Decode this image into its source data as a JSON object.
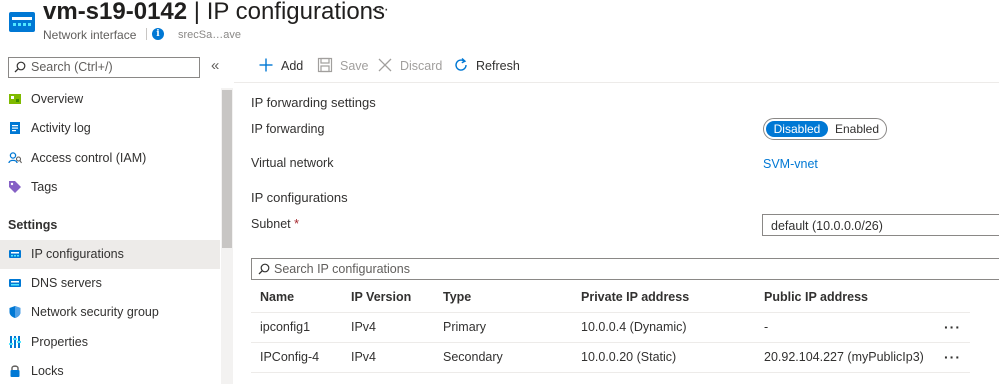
{
  "header": {
    "resource_name": "vm-s19-0142",
    "separator": " | ",
    "page_title": "IP configurations",
    "more_label": "···",
    "resource_type": "Network interface",
    "faded_text": "srecSa…ave"
  },
  "sidebar": {
    "search_placeholder": "Search (Ctrl+/)",
    "collapse_label": "«",
    "items": [
      {
        "label": "Overview",
        "icon": "overview-icon"
      },
      {
        "label": "Activity log",
        "icon": "activity-log-icon"
      },
      {
        "label": "Access control (IAM)",
        "icon": "iam-icon"
      },
      {
        "label": "Tags",
        "icon": "tag-icon"
      }
    ],
    "section_settings": "Settings",
    "settings_items": [
      {
        "label": "IP configurations",
        "icon": "ip-config-icon",
        "selected": true
      },
      {
        "label": "DNS servers",
        "icon": "dns-icon"
      },
      {
        "label": "Network security group",
        "icon": "shield-icon"
      },
      {
        "label": "Properties",
        "icon": "properties-icon"
      },
      {
        "label": "Locks",
        "icon": "lock-icon"
      }
    ]
  },
  "toolbar": {
    "add_label": "Add",
    "save_label": "Save",
    "discard_label": "Discard",
    "refresh_label": "Refresh"
  },
  "forwarding": {
    "section_title": "IP forwarding settings",
    "field_label": "IP forwarding",
    "option_disabled": "Disabled",
    "option_enabled": "Enabled",
    "selected": "Disabled"
  },
  "vnet": {
    "label": "Virtual network",
    "value": "SVM-vnet"
  },
  "ipconfigs": {
    "section_title": "IP configurations",
    "subnet_label": "Subnet",
    "required_mark": "*",
    "subnet_value": "default (10.0.0.0/26)",
    "search_placeholder": "Search IP configurations",
    "columns": [
      "Name",
      "IP Version",
      "Type",
      "Private IP address",
      "Public IP address"
    ],
    "rows": [
      {
        "name": "ipconfig1",
        "version": "IPv4",
        "type": "Primary",
        "private_ip": "10.0.0.4 (Dynamic)",
        "public_ip": "-",
        "more": "···"
      },
      {
        "name": "IPConfig-4",
        "version": "IPv4",
        "type": "Secondary",
        "private_ip": "10.0.0.20 (Static)",
        "public_ip": "20.92.104.227 (myPublicIp3)",
        "more": "···"
      }
    ]
  },
  "colors": {
    "accent": "#0078d4",
    "selected_bg": "#edebe9"
  }
}
